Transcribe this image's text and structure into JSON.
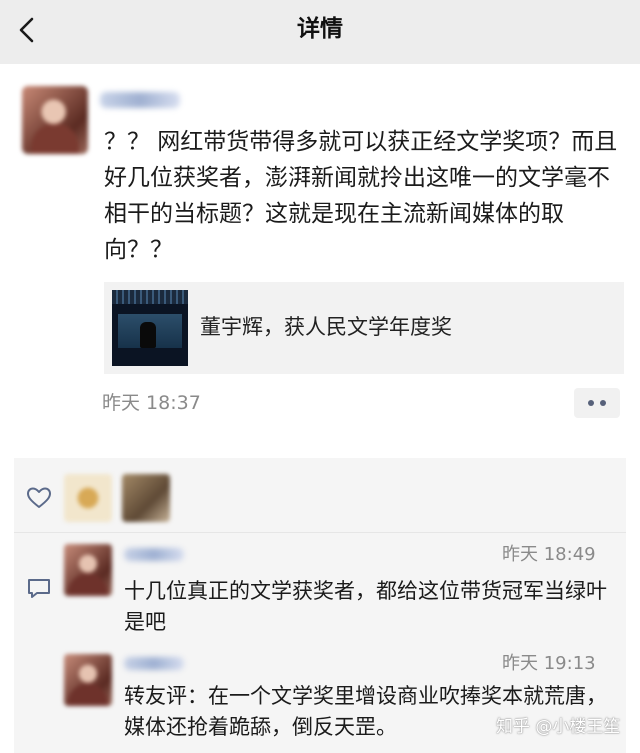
{
  "header": {
    "title": "详情",
    "back_icon": "chevron-left-icon"
  },
  "post": {
    "text": "？？ 网红带货带得多就可以获正经文学奖项？而且好几位获奖者，澎湃新闻就拎出这唯一的文学毫不相干的当标题？这就是现在主流新闻媒体的取向？？",
    "link_card": {
      "title": "董宇辉，获人民文学年度奖"
    },
    "time": "昨天 18:37"
  },
  "likes": {
    "icon": "heart-icon"
  },
  "comments": {
    "icon": "chat-bubble-icon",
    "items": [
      {
        "time": "昨天 18:49",
        "text": "十几位真正的文学获奖者，都给这位带货冠军当绿叶是吧"
      },
      {
        "time": "昨天 19:13",
        "text": "转友评：在一个文学奖里增设商业吹捧奖本就荒唐，媒体还抢着跪舔，倒反天罡。"
      }
    ]
  },
  "watermark": "知乎 @小楼王笙"
}
